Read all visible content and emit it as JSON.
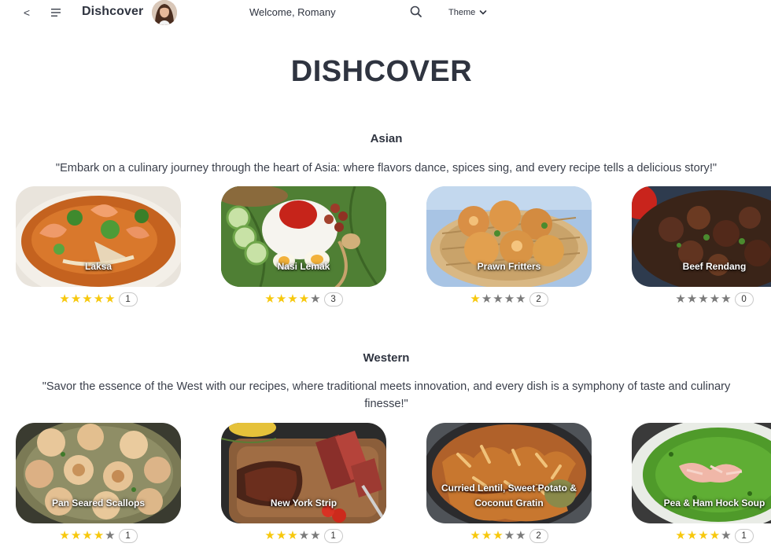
{
  "header": {
    "back_label": "<",
    "brand": "Dishcover",
    "welcome": "Welcome, Romany",
    "theme_label": "Theme"
  },
  "page_title": "DISHCOVER",
  "colors": {
    "star_on": "#f7c80d",
    "star_off": "#7a7a7a",
    "text": "#2f3440"
  },
  "sections": [
    {
      "title": "Asian",
      "description": "\"Embark on a culinary journey through the heart of Asia: where flavors dance, spices sing, and every recipe tells a delicious story!\"",
      "recipes": [
        {
          "name": "Laksa",
          "rating": 5,
          "count": "1"
        },
        {
          "name": "Nasi Lemak",
          "rating": 4,
          "count": "3"
        },
        {
          "name": "Prawn Fritters",
          "rating": 1,
          "count": "2"
        },
        {
          "name": "Beef Rendang",
          "rating": 0,
          "count": "0"
        }
      ]
    },
    {
      "title": "Western",
      "description": "\"Savor the essence of the West with our recipes, where traditional meets innovation, and every dish is a symphony of taste and culinary finesse!\"",
      "recipes": [
        {
          "name": "Pan Seared Scallops",
          "rating": 4,
          "count": "1"
        },
        {
          "name": "New York Strip",
          "rating": 3,
          "count": "1"
        },
        {
          "name": "Curried Lentil, Sweet Potato & Coconut Gratin",
          "rating": 3,
          "count": "2"
        },
        {
          "name": "Pea & Ham Hock Soup",
          "rating": 4,
          "count": "1"
        }
      ]
    }
  ]
}
